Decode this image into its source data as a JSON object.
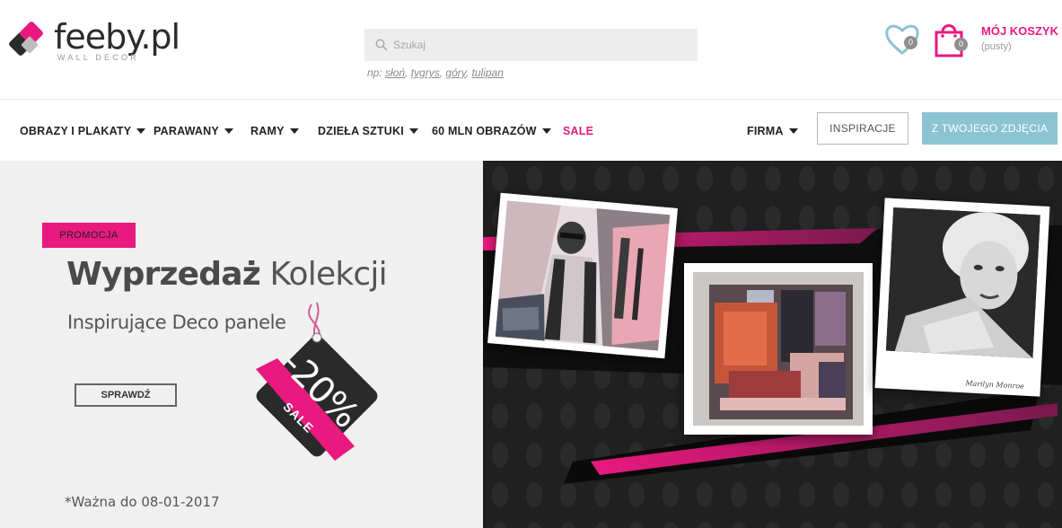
{
  "brand": {
    "name": "feeby.pl",
    "tagline": "WALL DECOR",
    "colors": {
      "accent": "#e8197f",
      "dark": "#2b2b2b",
      "button_blue": "#8cc3d3"
    }
  },
  "search": {
    "placeholder": "Szukaj",
    "hint_prefix": "np:",
    "suggestions": [
      "słoń",
      "tygrys",
      "góry",
      "tulipan"
    ]
  },
  "wishlist": {
    "count": "0",
    "icon": "heart-icon"
  },
  "cart": {
    "count": "0",
    "title": "MÓJ KOSZYK",
    "status": "(pusty)",
    "icon": "shopping-bag-icon"
  },
  "nav": {
    "items": [
      {
        "label": "OBRAZY I PLAKATY",
        "dropdown": true
      },
      {
        "label": "PARAWANY",
        "dropdown": true
      },
      {
        "label": "RAMY",
        "dropdown": true
      },
      {
        "label": "DZIEŁA SZTUKI",
        "dropdown": true
      },
      {
        "label": "60 MLN OBRAZÓW",
        "dropdown": true
      },
      {
        "label": "SALE",
        "dropdown": false
      }
    ],
    "company": {
      "label": "FIRMA",
      "dropdown": true
    },
    "inspiration_button": "INSPIRACJE",
    "photo_button": "Z TWOJEGO ZDJĘCIA"
  },
  "banner": {
    "promo_tag": "PROMOCJA",
    "headline_bold": "Wyprzedaż",
    "headline_rest": "Kolekcji",
    "subline": "Inspirujące Deco panele",
    "cta": "SPRAWDŹ",
    "discount": "-20%",
    "sale_ribbon": "SALE",
    "valid_until": "*Ważna do 08-01-2017",
    "signature": "Marilyn Monroe"
  }
}
